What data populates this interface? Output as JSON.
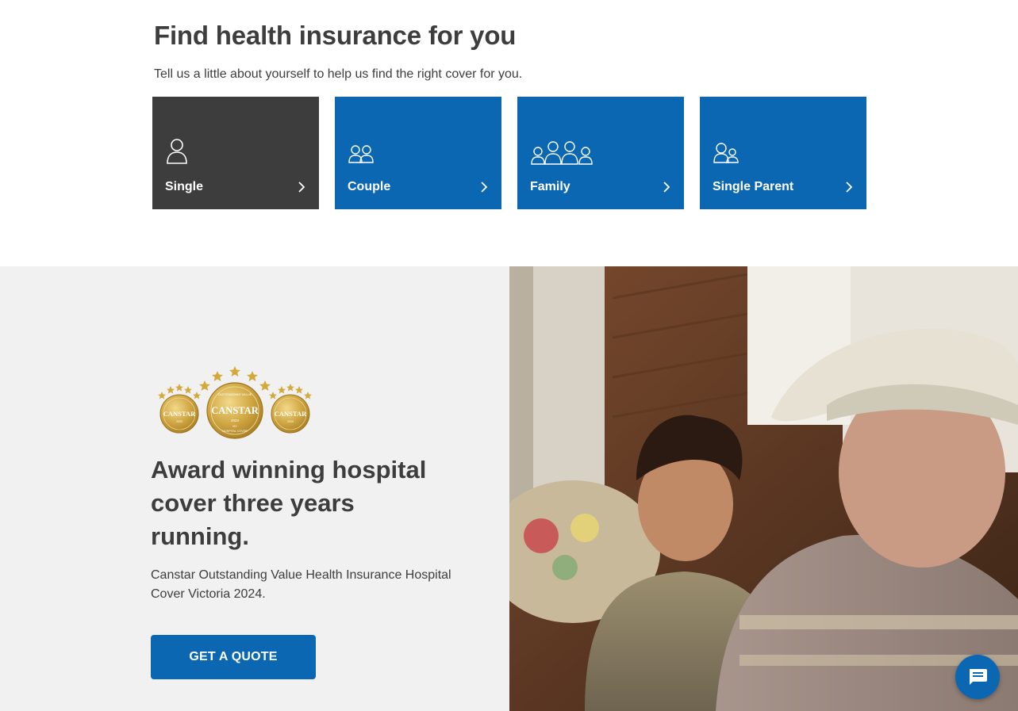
{
  "section": {
    "title": "Find health insurance for you",
    "subtitle": "Tell us a little about yourself to help us find the right cover for you."
  },
  "tiles": [
    {
      "label": "Single",
      "icon": "single-person-icon",
      "active": true
    },
    {
      "label": "Couple",
      "icon": "couple-icon",
      "active": false
    },
    {
      "label": "Family",
      "icon": "family-icon",
      "active": false
    },
    {
      "label": "Single Parent",
      "icon": "single-parent-icon",
      "active": false
    }
  ],
  "award": {
    "badges": [
      {
        "brand": "CANSTAR",
        "year": "2023"
      },
      {
        "brand": "CANSTAR",
        "year": "2024",
        "top": "OUTSTANDING VALUE",
        "bottom": "HOSPITAL COVER",
        "region": "VIC"
      },
      {
        "brand": "CANSTAR",
        "year": "2023"
      }
    ],
    "heading": "Award winning hospital cover three years running.",
    "description": "Canstar Outstanding Value Health Insurance Hospital Cover Victoria 2024.",
    "cta_label": "GET A QUOTE"
  },
  "colors": {
    "brand_blue": "#0b67b1",
    "active_tile": "#3d3d3d",
    "panel_bg": "#f1f1f1",
    "gold": "#c9a23a"
  },
  "chat": {
    "icon": "chat-icon"
  }
}
